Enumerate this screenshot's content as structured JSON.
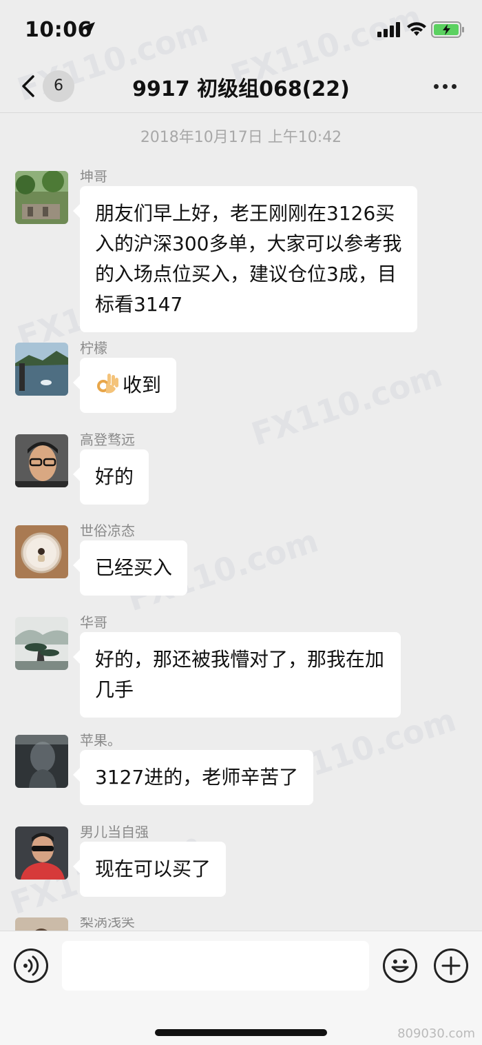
{
  "status_bar": {
    "time": "10:06"
  },
  "nav": {
    "badge": "6",
    "title": "9917  初级组068(22)"
  },
  "timestamp": "2018年10月17日 上午10:42",
  "messages": [
    {
      "sender": "坤哥",
      "text": "朋友们早上好，老王刚刚在3126买入的沪深300多单，大家可以参考我的入场点位买入，建议仓位3成，目标看3147"
    },
    {
      "sender": "柠檬",
      "text": "收到",
      "emoji": "ok-hand-icon"
    },
    {
      "sender": "高登骛远",
      "text": "好的"
    },
    {
      "sender": "世俗凉态",
      "text": "已经买入"
    },
    {
      "sender": "华哥",
      "text": "好的，那还被我懵对了，那我在加几手"
    },
    {
      "sender": "苹果。",
      "text": "3127进的，老师辛苦了"
    },
    {
      "sender": "男儿当自强",
      "text": "现在可以买了"
    },
    {
      "sender": "梨涡浅笑",
      "text": ""
    }
  ],
  "watermark": {
    "text": "FX110.com"
  },
  "site_mark": "809030.com",
  "colors": {
    "background": "#ededed",
    "bubble": "#ffffff",
    "battery": "#5bd160"
  }
}
